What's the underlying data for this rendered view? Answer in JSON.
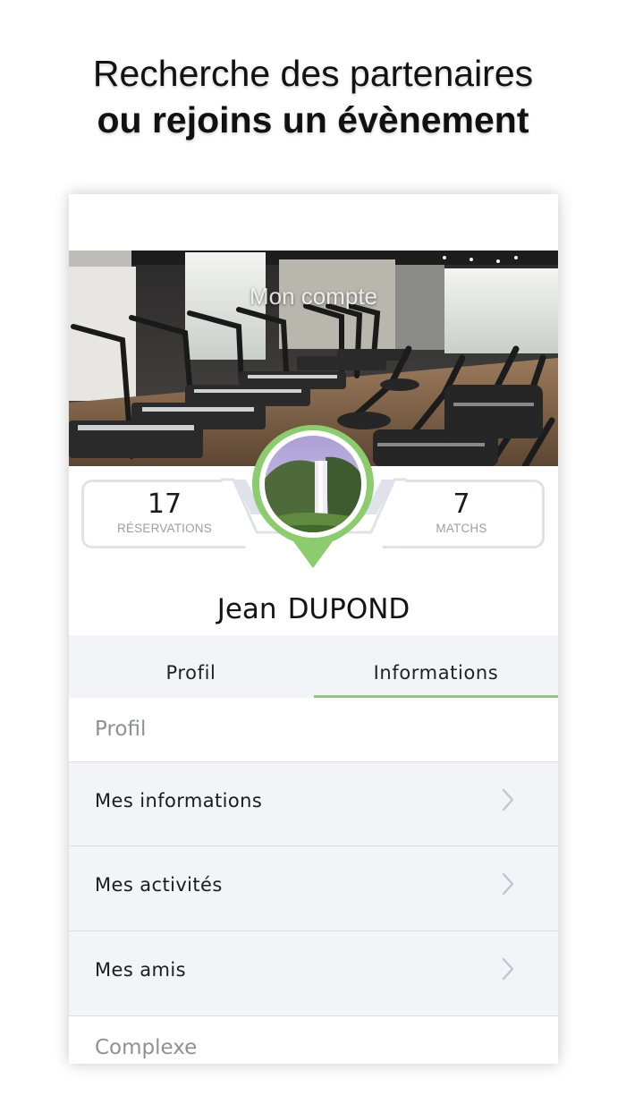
{
  "promo": {
    "line1": "Recherche des partenaires",
    "line2": "ou rejoins un évènement"
  },
  "header": {
    "title": "Mon compte"
  },
  "stats": {
    "reservations": {
      "value": "17",
      "label": "RÉSERVATIONS"
    },
    "matchs": {
      "value": "7",
      "label": "MATCHS"
    }
  },
  "user": {
    "first_name": "Jean",
    "last_name": "DUPOND"
  },
  "tabs": [
    {
      "label": "Profil",
      "active": false
    },
    {
      "label": "Informations",
      "active": true
    }
  ],
  "sections": [
    {
      "title": "Profil",
      "items": [
        "Mes informations",
        "Mes activités",
        "Mes amis"
      ]
    },
    {
      "title": "Complexe",
      "items": []
    }
  ],
  "colors": {
    "accent": "#8ccb6e",
    "row_bg": "#f3f4f8",
    "divider": "#dcdde3",
    "section_text": "#8d9096"
  },
  "icons": {
    "row_chevron": "chevron-right-icon"
  }
}
